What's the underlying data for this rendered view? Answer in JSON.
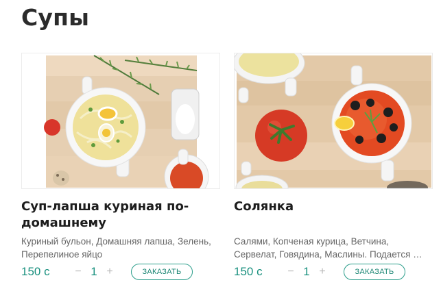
{
  "section": {
    "title": "Супы"
  },
  "products": [
    {
      "name": "Суп-лапша куриная по-домашнему",
      "description": "Куриный бульон, Домашняя лапша, Зелень, Перепелиное яйцо",
      "price": "150 с",
      "quantity": "1",
      "minus": "−",
      "plus": "+",
      "order_label": "ЗАКАЗАТЬ",
      "image_icon": "chicken-noodle-soup-photo"
    },
    {
      "name": "Солянка",
      "description": "Салями, Копченая курица, Ветчина, Сервелат, Говядина, Маслины. Подается …",
      "price": "150 с",
      "quantity": "1",
      "minus": "−",
      "plus": "+",
      "order_label": "ЗАКАЗАТЬ",
      "image_icon": "solyanka-soup-photo"
    }
  ],
  "colors": {
    "accent": "#18907e",
    "button_border": "#2a9d8a",
    "title": "#2b2b2b"
  }
}
